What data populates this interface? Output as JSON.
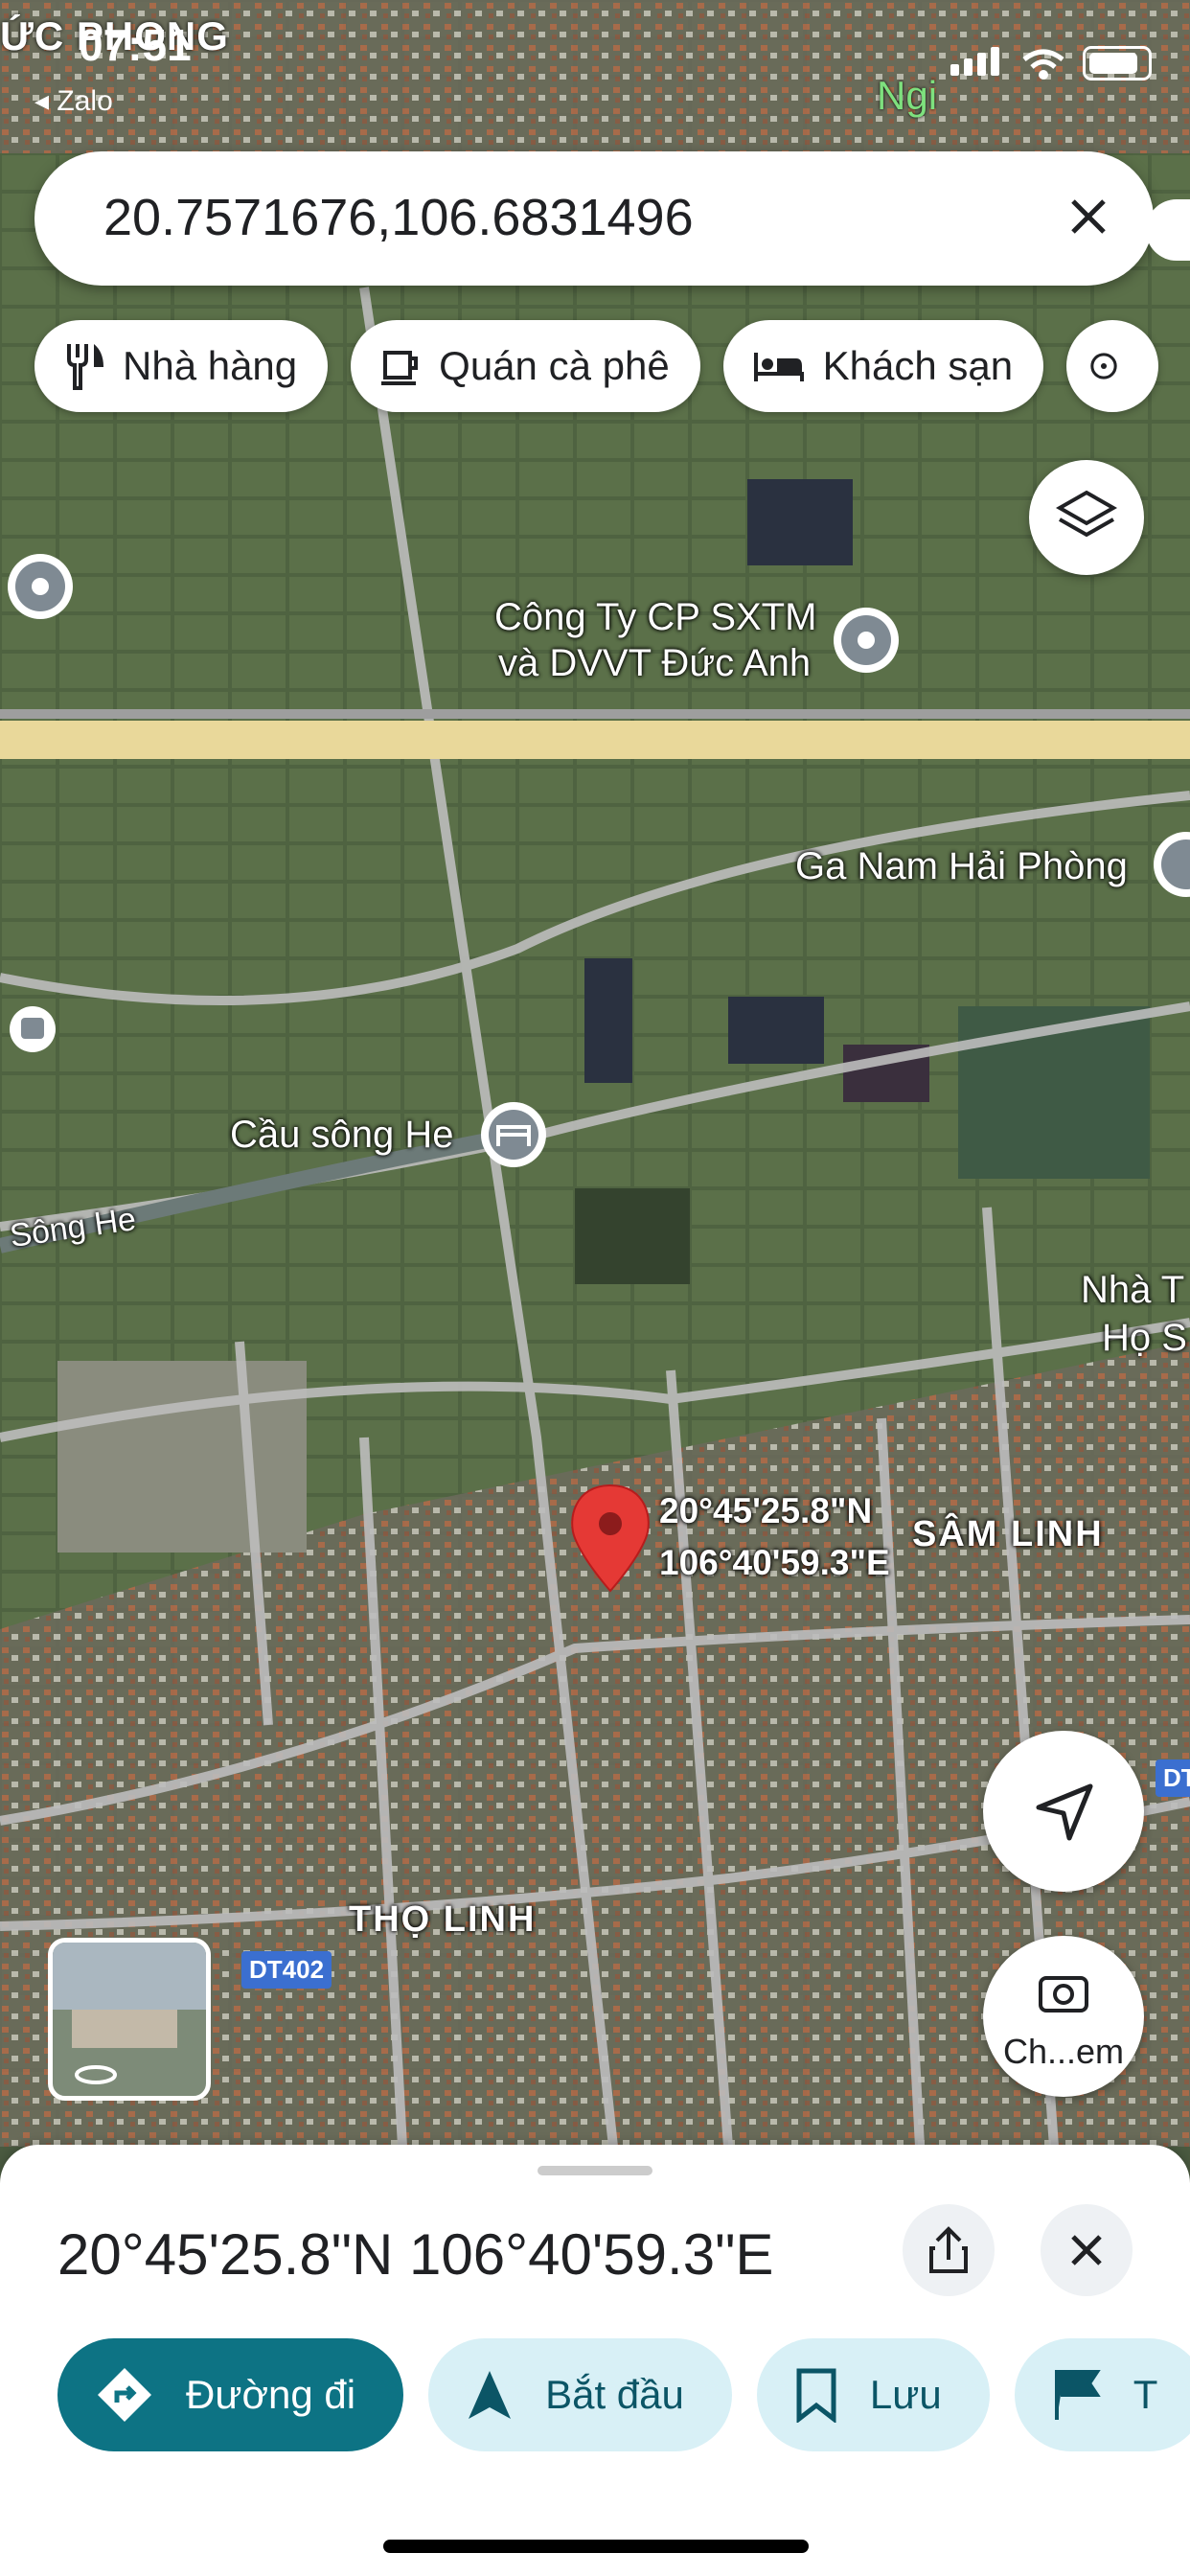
{
  "status_bar": {
    "top_place_name": "ỨC PHONG",
    "time": "07:51",
    "back_app": "◂ Zalo",
    "right_label": "Ngi"
  },
  "search": {
    "query": "20.7571676,106.6831496"
  },
  "chips": [
    {
      "label": "Nhà hàng",
      "icon": "restaurant-icon"
    },
    {
      "label": "Quán cà phê",
      "icon": "coffee-icon"
    },
    {
      "label": "Khách sạn",
      "icon": "hotel-icon"
    }
  ],
  "map": {
    "labels": {
      "company_line1": "Công Ty CP SXTM",
      "company_line2": "và DVVT Đức Anh",
      "station": "Ga Nam Hải Phòng",
      "bridge": "Cầu sông He",
      "river": "Sông He",
      "nha_line1": "Nhà T",
      "nha_line2": "Họ S",
      "sam_linh": "SÂM LINH",
      "tho_linh": "THỌ LINH",
      "road_dt402": "DT402",
      "road_dt": "DT"
    },
    "pin": {
      "lat_label": "20°45'25.8\"N",
      "lon_label": "106°40'59.3\"E"
    },
    "camera_button_label": "Ch...em"
  },
  "sheet": {
    "coordinates": "20°45'25.8\"N 106°40'59.3\"E",
    "actions": [
      {
        "label": "Đường đi",
        "icon": "directions-icon"
      },
      {
        "label": "Bắt đầu",
        "icon": "navigation-arrow-icon"
      },
      {
        "label": "Lưu",
        "icon": "bookmark-icon"
      },
      {
        "label": "T",
        "icon": "flag-icon"
      }
    ]
  },
  "colors": {
    "primary": "#0d7384",
    "pin": "#e53935",
    "road": "#bdbdbd",
    "highway": "#e9d89a"
  }
}
